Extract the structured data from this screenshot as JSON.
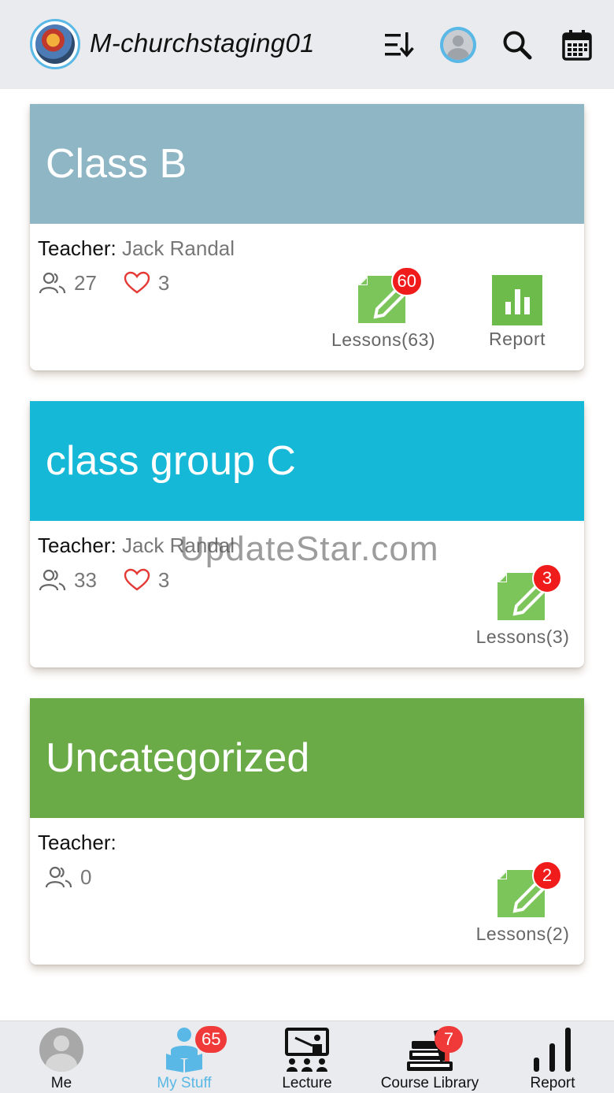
{
  "header": {
    "title": "M-churchstaging01",
    "icons": [
      "church-logo",
      "sort-icon",
      "user-avatar",
      "search-icon",
      "calendar-icon"
    ]
  },
  "cards": [
    {
      "title": "Class B",
      "header_color": "#8fb6c4",
      "teacher_label": "Teacher:",
      "teacher_name": "Jack Randal",
      "members": "27",
      "likes": "3",
      "lessons_label": "Lessons(63)",
      "lessons_badge": "60",
      "report_label": "Report"
    },
    {
      "title": "class group C",
      "header_color": "#16b8d8",
      "teacher_label": "Teacher:",
      "teacher_name": "Jack Randal",
      "members": "33",
      "likes": "3",
      "lessons_label": "Lessons(3)",
      "lessons_badge": "3"
    },
    {
      "title": "Uncategorized",
      "header_color": "#6aab48",
      "teacher_label": "Teacher:",
      "teacher_name": "",
      "members": "0",
      "lessons_label": "Lessons(2)",
      "lessons_badge": "2"
    }
  ],
  "watermark": "UpdateStar.com",
  "bottom_nav": {
    "items": [
      {
        "label": "Me",
        "icon": "avatar"
      },
      {
        "label": "My Stuff",
        "icon": "reader-icon",
        "badge": "65",
        "active": true
      },
      {
        "label": "Lecture",
        "icon": "lecture-icon"
      },
      {
        "label": "Course Library",
        "icon": "books-icon",
        "badge": "7"
      },
      {
        "label": "Report",
        "icon": "bar-chart-icon"
      }
    ],
    "active_color": "#5ab8e6",
    "badge_color": "#f03a3a"
  },
  "colors": {
    "lesson_icon": "#7cc55a",
    "report_icon": "#6dbb4a",
    "heart": "#e53935",
    "header_bg": "#e9ebee"
  }
}
